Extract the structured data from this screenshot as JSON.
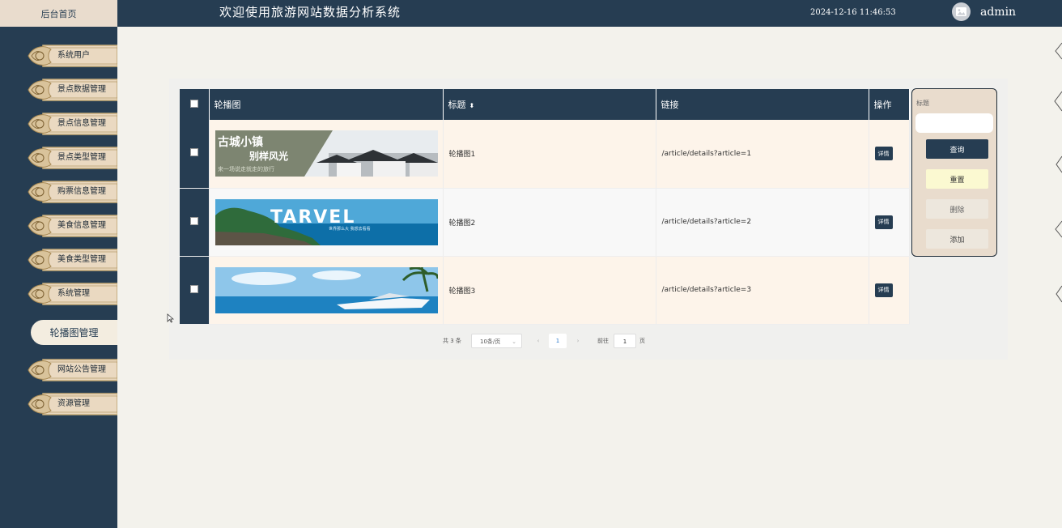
{
  "header": {
    "home_label": "后台首页",
    "title": "欢迎使用旅游网站数据分析系统",
    "datetime": "2024-12-16 11:46:53",
    "username": "admin"
  },
  "sidebar": {
    "items": [
      {
        "label": "系统用户"
      },
      {
        "label": "景点数据管理"
      },
      {
        "label": "景点信息管理"
      },
      {
        "label": "景点类型管理"
      },
      {
        "label": "购票信息管理"
      },
      {
        "label": "美食信息管理"
      },
      {
        "label": "美食类型管理"
      },
      {
        "label": "系统管理"
      },
      {
        "label": "轮播图管理",
        "active": true
      },
      {
        "label": "网站公告管理"
      },
      {
        "label": "资源管理"
      }
    ]
  },
  "table": {
    "columns": [
      "轮播图",
      "标题",
      "链接",
      "操作"
    ],
    "rows": [
      {
        "title": "轮播图1",
        "link": "/article/details?article=1",
        "action": "详情",
        "banner_text": {
          "line1": "古城小镇",
          "line2": "别样风光",
          "line3": "来一场说走就走的旅行"
        }
      },
      {
        "title": "轮播图2",
        "link": "/article/details?article=2",
        "action": "详情",
        "banner_text": {
          "line1": "TARVEL",
          "line2": "世界那么大 我想去看看"
        }
      },
      {
        "title": "轮播图3",
        "link": "/article/details?article=3",
        "action": "详情"
      }
    ]
  },
  "search": {
    "label": "标题",
    "query": "查询",
    "reset": "重置",
    "delete": "删除",
    "add": "添加"
  },
  "pagination": {
    "total": "共 3 条",
    "page_size": "10条/页",
    "current_page": "1",
    "goto_label": "前往",
    "goto_value": "1",
    "page_unit": "页"
  },
  "colors": {
    "navy": "#263d52",
    "beige": "#e9dccd",
    "gold": "#c9ae7a",
    "row_odd": "#fdf4ea"
  }
}
